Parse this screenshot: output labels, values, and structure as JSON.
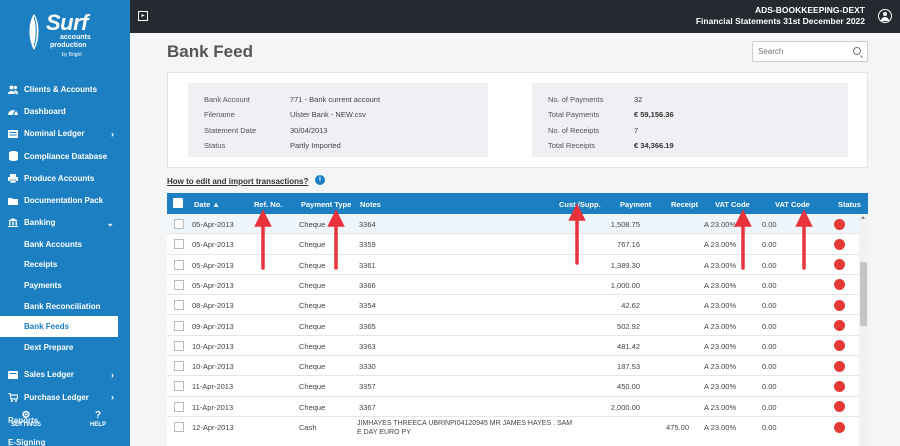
{
  "brand": {
    "name": "Surf",
    "line1": "accounts",
    "line2": "production",
    "line3": "by Bright"
  },
  "topbar": {
    "company": "ADS-BOOKKEEPING-DEXT",
    "period": "Financial Statements 31st December 2022"
  },
  "sidebar": {
    "items": [
      {
        "label": "Clients & Accounts",
        "icon": "users-icon",
        "chevron": false
      },
      {
        "label": "Dashboard",
        "icon": "dashboard-icon",
        "chevron": false
      },
      {
        "label": "Nominal Ledger",
        "icon": "ledger-icon",
        "chevron": true
      },
      {
        "label": "Compliance Database",
        "icon": "database-icon",
        "chevron": false
      },
      {
        "label": "Produce Accounts",
        "icon": "print-icon",
        "chevron": false
      },
      {
        "label": "Documentation Pack",
        "icon": "folder-icon",
        "chevron": false
      },
      {
        "label": "Banking",
        "icon": "bank-icon",
        "chevron": true
      }
    ],
    "banking_sub": [
      {
        "label": "Bank Accounts"
      },
      {
        "label": "Receipts"
      },
      {
        "label": "Payments"
      },
      {
        "label": "Bank Reconciliation"
      },
      {
        "label": "Bank Feeds",
        "active": true
      },
      {
        "label": "Dext Prepare"
      }
    ],
    "after": [
      {
        "label": "Sales Ledger",
        "icon": "sales-icon"
      },
      {
        "label": "Purchase Ledger",
        "icon": "purchase-icon"
      }
    ],
    "reports": "Reports",
    "esigning": "E-Signing",
    "settings": "SETTINGS",
    "help": "HELP"
  },
  "page": {
    "title": "Bank Feed",
    "search_placeholder": "Search",
    "howto": "How to edit and import transactions?"
  },
  "summary": {
    "left": [
      {
        "label": "Bank Account",
        "value": "771 - Bank current account"
      },
      {
        "label": "Filename",
        "value": "Ulster Bank - NEW.csv"
      },
      {
        "label": "Statement Date",
        "value": "30/04/2013"
      },
      {
        "label": "Status",
        "value": "Partly Imported"
      }
    ],
    "right": [
      {
        "label": "No. of Payments",
        "value": "32",
        "bold": false
      },
      {
        "label": "Total Payments",
        "value": "€ 59,156.36",
        "bold": true
      },
      {
        "label": "No. of Receipts",
        "value": "7",
        "bold": false
      },
      {
        "label": "Total Receipts",
        "value": "€ 34,366.19",
        "bold": true
      }
    ]
  },
  "table": {
    "headers": [
      "Date ▲",
      "Ref. No.",
      "Payment Type",
      "Notes",
      "Cust./Supp.",
      "Payment",
      "Receipt",
      "VAT Code",
      "VAT Code",
      "Status"
    ],
    "rows": [
      {
        "date": "05-Apr-2013",
        "ref": "",
        "type": "Cheque",
        "notes": "3364",
        "cust": "",
        "payment": "1,508.75",
        "receipt": "",
        "vat1": "A 23.00%",
        "vat2": "0.00"
      },
      {
        "date": "05-Apr-2013",
        "ref": "",
        "type": "Cheque",
        "notes": "3359",
        "cust": "",
        "payment": "767.16",
        "receipt": "",
        "vat1": "A 23.00%",
        "vat2": "0.00"
      },
      {
        "date": "05-Apr-2013",
        "ref": "",
        "type": "Cheque",
        "notes": "3361",
        "cust": "",
        "payment": "1,389.30",
        "receipt": "",
        "vat1": "A 23.00%",
        "vat2": "0.00"
      },
      {
        "date": "05-Apr-2013",
        "ref": "",
        "type": "Cheque",
        "notes": "3366",
        "cust": "",
        "payment": "1,000.00",
        "receipt": "",
        "vat1": "A 23.00%",
        "vat2": "0.00"
      },
      {
        "date": "08-Apr-2013",
        "ref": "",
        "type": "Cheque",
        "notes": "3354",
        "cust": "",
        "payment": "42.62",
        "receipt": "",
        "vat1": "A 23.00%",
        "vat2": "0.00"
      },
      {
        "date": "09-Apr-2013",
        "ref": "",
        "type": "Cheque",
        "notes": "3365",
        "cust": "",
        "payment": "502.92",
        "receipt": "",
        "vat1": "A 23.00%",
        "vat2": "0.00"
      },
      {
        "date": "10-Apr-2013",
        "ref": "",
        "type": "Cheque",
        "notes": "3363",
        "cust": "",
        "payment": "481.42",
        "receipt": "",
        "vat1": "A 23.00%",
        "vat2": "0.00"
      },
      {
        "date": "10-Apr-2013",
        "ref": "",
        "type": "Cheque",
        "notes": "3330",
        "cust": "",
        "payment": "187.53",
        "receipt": "",
        "vat1": "A 23.00%",
        "vat2": "0.00"
      },
      {
        "date": "11-Apr-2013",
        "ref": "",
        "type": "Cheque",
        "notes": "3357",
        "cust": "",
        "payment": "450.00",
        "receipt": "",
        "vat1": "A 23.00%",
        "vat2": "0.00"
      },
      {
        "date": "11-Apr-2013",
        "ref": "",
        "type": "Cheque",
        "notes": "3367",
        "cust": "",
        "payment": "2,000.00",
        "receipt": "",
        "vat1": "A 23.00%",
        "vat2": "0.00"
      },
      {
        "date": "12-Apr-2013",
        "ref": "",
        "type": "Cash",
        "notes": "JIMHAYES THREECA UBRINPI04120945 MR JAMES HAYES . SAM E DAY EURO PY",
        "cust": "",
        "payment": "",
        "receipt": "475.00",
        "vat1": "A 23.00%",
        "vat2": "0.00"
      }
    ]
  },
  "colors": {
    "sidebar": "#1b7fc1",
    "topbar": "#252a30",
    "status_red": "#e53935",
    "arrow_red": "#e8323c"
  }
}
